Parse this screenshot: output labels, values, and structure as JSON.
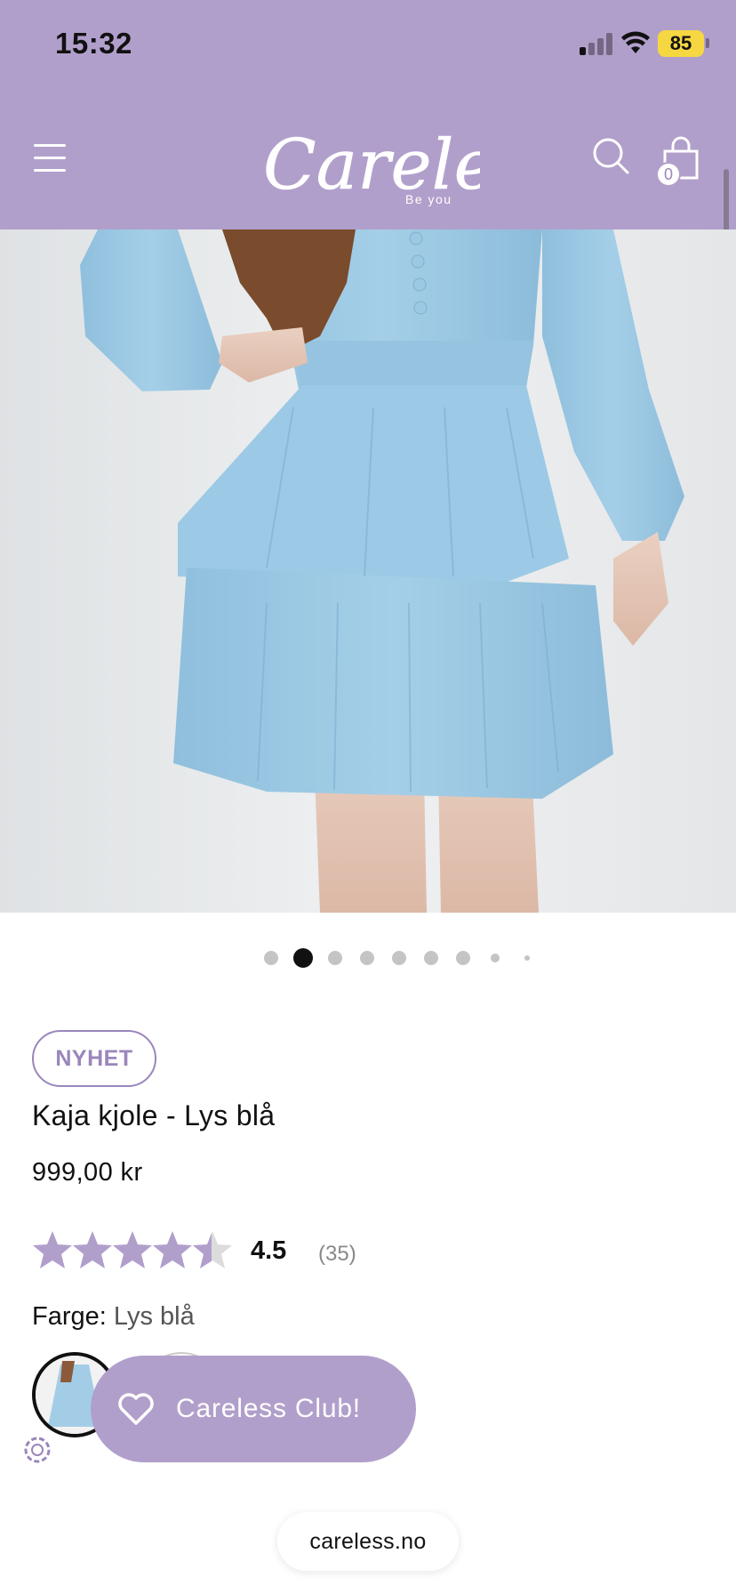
{
  "status_bar": {
    "time": "15:32",
    "battery": "85"
  },
  "header": {
    "logo_text": "Careless",
    "logo_tagline": "Be you",
    "cart_count": "0",
    "background_color": "#b19fcb"
  },
  "gallery": {
    "total_images": 9,
    "active_index": 1
  },
  "product": {
    "badge": "NYHET",
    "title": "Kaja kjole - Lys blå",
    "price": "999,00 kr",
    "rating": 4.5,
    "rating_label": "4.5",
    "review_count": "(35)",
    "color_label": "Farge:",
    "color_value": "Lys blå"
  },
  "club_button": {
    "label": "Careless Club!"
  },
  "browser": {
    "url": "careless.no"
  },
  "icons": [
    "menu-icon",
    "search-icon",
    "cart-icon",
    "heart-icon",
    "accessibility-icon"
  ]
}
